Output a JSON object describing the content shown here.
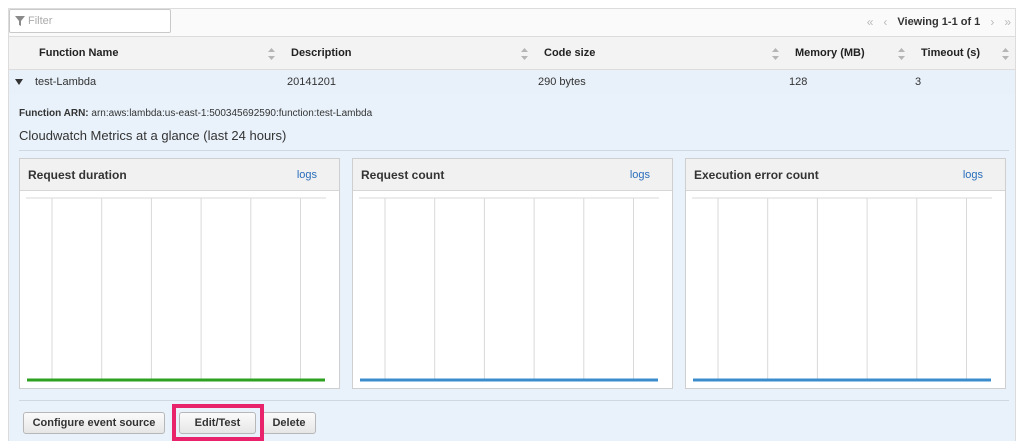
{
  "filter": {
    "placeholder": "Filter"
  },
  "pager": {
    "first": "«",
    "prev": "‹",
    "viewing": "Viewing 1-1 of 1",
    "next": "›",
    "last": "»"
  },
  "table": {
    "columns": [
      "Function Name",
      "Description",
      "Code size",
      "Memory (MB)",
      "Timeout (s)"
    ],
    "rows": [
      {
        "name": "test-Lambda",
        "description": "20141201",
        "code_size": "290 bytes",
        "memory": "128",
        "timeout": "3"
      }
    ]
  },
  "detail": {
    "arn_label": "Function ARN:",
    "arn_value": "arn:aws:lambda:us-east-1:500345692590:function:test-Lambda",
    "metrics_title": "Cloudwatch Metrics at a glance (last 24 hours)",
    "panels": [
      {
        "title": "Request duration",
        "link": "logs",
        "line_color": "#2ea121"
      },
      {
        "title": "Request count",
        "link": "logs",
        "line_color": "#3c8ccc"
      },
      {
        "title": "Execution error count",
        "link": "logs",
        "line_color": "#3c8ccc"
      }
    ]
  },
  "actions": {
    "configure": "Configure event source",
    "edit": "Edit/Test",
    "delete": "Delete"
  },
  "colors": {
    "highlight": "#e8236b",
    "link": "#2a6ebb"
  }
}
